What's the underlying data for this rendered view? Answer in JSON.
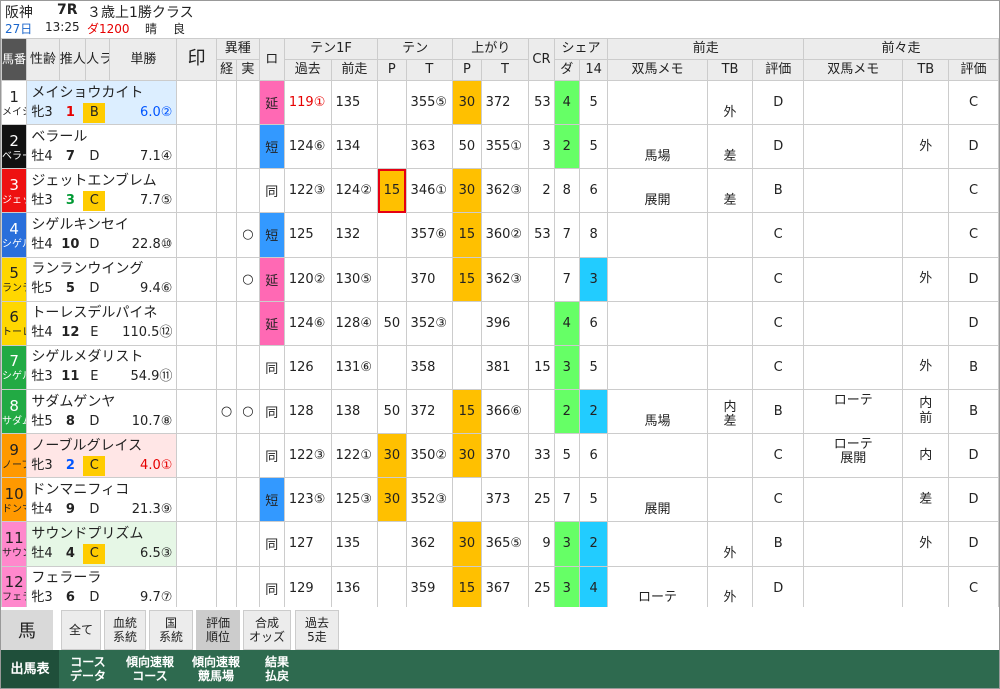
{
  "race": {
    "venue": "阪神",
    "round": "7R",
    "name": "３歳上1勝クラス",
    "day": "27日",
    "time": "13:25",
    "course": "ダ1200",
    "weather": "晴",
    "condition": "良"
  },
  "headers": {
    "umaban": "馬番↑",
    "seirei": "性齢",
    "suikan": "推人",
    "ninki": "人ラ",
    "tansho": "単勝",
    "shirushi": "印",
    "ishu": "異種",
    "ishu_kei": "経",
    "ishu_jitsu": "実",
    "ro": "ロ",
    "ten1f": "テン1F",
    "kako": "過去",
    "zenso_t": "前走",
    "ten": "テン",
    "p": "P",
    "t": "T",
    "agari": "上がり",
    "cr": "CR",
    "share": "シェア",
    "da": "ダ",
    "n14": "14",
    "zenso": "前走",
    "zenzenso": "前々走",
    "memo": "双馬メモ",
    "tb": "TB",
    "hyoka": "評価"
  },
  "horses": [
    {
      "num": "1",
      "abbr": "メイシ",
      "numColor": "#ffffff",
      "numText": "#222",
      "name": "メイショウカイト",
      "sex": "牝3",
      "ninki": "1",
      "ninkiColor": "red",
      "rank": "B",
      "rankHL": true,
      "odds": "6.0②",
      "oddsColor": "bluet",
      "kei": "",
      "jitsu": "",
      "ro": "延",
      "roColor": "bg-pink",
      "ten_kako": "119①",
      "ten_kakoColor": "red",
      "ten_zen": "135",
      "ten_zenColor": "",
      "ten_p": "",
      "ten_pColor": "",
      "ten_t": "355⑤",
      "ten_tColor": "",
      "agari_p": "30",
      "agari_pColor": "bg-yellow",
      "agari_t": "372",
      "agari_tColor": "",
      "cr": "53",
      "da": "4",
      "daColor": "bg-green",
      "n14": "5",
      "n14Color": "",
      "z_memo": "",
      "z_tb": "外",
      "z_hyoka": "D",
      "zz_memo": "",
      "zz_tb": "",
      "zz_hyoka": "C",
      "rowbg": "rowbg1"
    },
    {
      "num": "2",
      "abbr": "ベラー",
      "numColor": "#111111",
      "numText": "#fff",
      "name": "ベラール",
      "sex": "牡4",
      "ninki": "7",
      "ninkiColor": "",
      "rank": "D",
      "rankHL": false,
      "odds": "7.1④",
      "oddsColor": "",
      "kei": "",
      "jitsu": "",
      "ro": "短",
      "roColor": "bg-blue",
      "ten_kako": "124⑥",
      "ten_kakoColor": "",
      "ten_zen": "134",
      "ten_zenColor": "",
      "ten_p": "",
      "ten_pColor": "",
      "ten_t": "363",
      "ten_tColor": "",
      "agari_p": "50",
      "agari_pColor": "",
      "agari_t": "355①",
      "agari_tColor": "",
      "cr": "3",
      "da": "2",
      "daColor": "bg-green",
      "n14": "5",
      "n14Color": "",
      "z_memo": "馬場",
      "z_tb": "差",
      "z_hyoka": "D",
      "zz_memo": "",
      "zz_tb": "外",
      "zz_hyoka": "D",
      "rowbg": ""
    },
    {
      "num": "3",
      "abbr": "ジェッ",
      "numColor": "#ee1111",
      "numText": "#fff",
      "name": "ジェットエンブレム",
      "sex": "牡3",
      "ninki": "3",
      "ninkiColor": "green",
      "rank": "C",
      "rankHL": true,
      "odds": "7.7⑤",
      "oddsColor": "",
      "kei": "",
      "jitsu": "",
      "ro": "同",
      "roColor": "",
      "ten_kako": "122③",
      "ten_kakoColor": "",
      "ten_zen": "124②",
      "ten_zenColor": "",
      "ten_p": "15",
      "ten_pColor": "bg-yellow",
      "ten_t": "346①",
      "ten_tColor": "",
      "agari_p": "30",
      "agari_pColor": "bg-yellow",
      "agari_t": "362③",
      "agari_tColor": "",
      "cr": "2",
      "da": "8",
      "daColor": "",
      "n14": "6",
      "n14Color": "",
      "z_memo": "展開",
      "z_tb": "差",
      "z_hyoka": "B",
      "zz_memo": "",
      "zz_tb": "",
      "zz_hyoka": "C",
      "rowbg": ""
    },
    {
      "num": "4",
      "abbr": "シゲル",
      "numColor": "#2a6fdb",
      "numText": "#fff",
      "name": "シゲルキンセイ",
      "sex": "牡4",
      "ninki": "10",
      "ninkiColor": "",
      "rank": "D",
      "rankHL": false,
      "odds": "22.8⑩",
      "oddsColor": "",
      "kei": "",
      "jitsu": "○",
      "ro": "短",
      "roColor": "bg-blue",
      "ten_kako": "125",
      "ten_kakoColor": "",
      "ten_zen": "132",
      "ten_zenColor": "",
      "ten_p": "",
      "ten_pColor": "",
      "ten_t": "357⑥",
      "ten_tColor": "",
      "agari_p": "15",
      "agari_pColor": "bg-yellow",
      "agari_t": "360②",
      "agari_tColor": "",
      "cr": "53",
      "da": "7",
      "daColor": "",
      "n14": "8",
      "n14Color": "",
      "z_memo": "",
      "z_tb": "",
      "z_hyoka": "C",
      "zz_memo": "",
      "zz_tb": "",
      "zz_hyoka": "C",
      "rowbg": ""
    },
    {
      "num": "5",
      "abbr": "ランラ",
      "numColor": "#ffd700",
      "numText": "#222",
      "name": "ランランウイング",
      "sex": "牝5",
      "ninki": "5",
      "ninkiColor": "",
      "rank": "D",
      "rankHL": false,
      "odds": "9.4⑥",
      "oddsColor": "",
      "kei": "",
      "jitsu": "○",
      "ro": "延",
      "roColor": "bg-pink",
      "ten_kako": "120②",
      "ten_kakoColor": "",
      "ten_zen": "130⑤",
      "ten_zenColor": "",
      "ten_p": "",
      "ten_pColor": "",
      "ten_t": "370",
      "ten_tColor": "",
      "agari_p": "15",
      "agari_pColor": "bg-yellow",
      "agari_t": "362③",
      "agari_tColor": "",
      "cr": "",
      "da": "7",
      "daColor": "",
      "n14": "3",
      "n14Color": "bg-cyan",
      "z_memo": "",
      "z_tb": "",
      "z_hyoka": "C",
      "zz_memo": "",
      "zz_tb": "外",
      "zz_hyoka": "D",
      "rowbg": ""
    },
    {
      "num": "6",
      "abbr": "トーレ",
      "numColor": "#ffd700",
      "numText": "#222",
      "name": "トーレスデルパイネ",
      "sex": "牡4",
      "ninki": "12",
      "ninkiColor": "",
      "rank": "E",
      "rankHL": false,
      "odds": "110.5⑫",
      "oddsColor": "",
      "kei": "",
      "jitsu": "",
      "ro": "延",
      "roColor": "bg-pink",
      "ten_kako": "124⑥",
      "ten_kakoColor": "",
      "ten_zen": "128④",
      "ten_zenColor": "",
      "ten_p": "50",
      "ten_pColor": "",
      "ten_t": "352③",
      "ten_tColor": "",
      "agari_p": "",
      "agari_pColor": "",
      "agari_t": "396",
      "agari_tColor": "",
      "cr": "",
      "da": "4",
      "daColor": "bg-green",
      "n14": "6",
      "n14Color": "",
      "z_memo": "",
      "z_tb": "",
      "z_hyoka": "C",
      "zz_memo": "",
      "zz_tb": "",
      "zz_hyoka": "D",
      "rowbg": ""
    },
    {
      "num": "7",
      "abbr": "シゲル",
      "numColor": "#22aa44",
      "numText": "#fff",
      "name": "シゲルメダリスト",
      "sex": "牡3",
      "ninki": "11",
      "ninkiColor": "",
      "rank": "E",
      "rankHL": false,
      "odds": "54.9⑪",
      "oddsColor": "",
      "kei": "",
      "jitsu": "",
      "ro": "同",
      "roColor": "",
      "ten_kako": "126",
      "ten_kakoColor": "",
      "ten_zen": "131⑥",
      "ten_zenColor": "",
      "ten_p": "",
      "ten_pColor": "",
      "ten_t": "358",
      "ten_tColor": "",
      "agari_p": "",
      "agari_pColor": "",
      "agari_t": "381",
      "agari_tColor": "",
      "cr": "15",
      "da": "3",
      "daColor": "bg-green",
      "n14": "5",
      "n14Color": "",
      "z_memo": "",
      "z_tb": "",
      "z_hyoka": "C",
      "zz_memo": "",
      "zz_tb": "外",
      "zz_hyoka": "B",
      "rowbg": ""
    },
    {
      "num": "8",
      "abbr": "サダム",
      "numColor": "#22aa44",
      "numText": "#fff",
      "name": "サダムゲンヤ",
      "sex": "牡5",
      "ninki": "8",
      "ninkiColor": "",
      "rank": "D",
      "rankHL": false,
      "odds": "10.7⑧",
      "oddsColor": "",
      "kei": "○",
      "jitsu": "○",
      "ro": "同",
      "roColor": "",
      "ten_kako": "128",
      "ten_kakoColor": "",
      "ten_zen": "138",
      "ten_zenColor": "",
      "ten_p": "50",
      "ten_pColor": "",
      "ten_t": "372",
      "ten_tColor": "",
      "agari_p": "15",
      "agari_pColor": "bg-yellow",
      "agari_t": "366⑥",
      "agari_tColor": "",
      "cr": "",
      "da": "2",
      "daColor": "bg-green",
      "n14": "2",
      "n14Color": "bg-cyan",
      "z_memo": "馬場",
      "z_tb": "内\n差",
      "z_hyoka": "B",
      "zz_memo": "ローテ",
      "zz_tb": "内\n前",
      "zz_hyoka": "B",
      "rowbg": ""
    },
    {
      "num": "9",
      "abbr": "ノーブ",
      "numColor": "#ff9900",
      "numText": "#222",
      "name": "ノーブルグレイス",
      "sex": "牝3",
      "ninki": "2",
      "ninkiColor": "bluet",
      "rank": "C",
      "rankHL": true,
      "odds": "4.0①",
      "oddsColor": "red",
      "kei": "",
      "jitsu": "",
      "ro": "同",
      "roColor": "",
      "ten_kako": "122③",
      "ten_kakoColor": "",
      "ten_zen": "122①",
      "ten_zenColor": "",
      "ten_p": "30",
      "ten_pColor": "bg-yellow",
      "ten_t": "350②",
      "ten_tColor": "",
      "agari_p": "30",
      "agari_pColor": "bg-yellow",
      "agari_t": "370",
      "agari_tColor": "",
      "cr": "33",
      "da": "5",
      "daColor": "",
      "n14": "6",
      "n14Color": "",
      "z_memo": "",
      "z_tb": "",
      "z_hyoka": "C",
      "zz_memo": "ローテ\n展開",
      "zz_tb": "内",
      "zz_hyoka": "D",
      "rowbg": "rowbg2"
    },
    {
      "num": "10",
      "abbr": "ドンマ",
      "numColor": "#ff9900",
      "numText": "#222",
      "name": "ドンマニフィコ",
      "sex": "牡4",
      "ninki": "9",
      "ninkiColor": "",
      "rank": "D",
      "rankHL": false,
      "odds": "21.3⑨",
      "oddsColor": "",
      "kei": "",
      "jitsu": "",
      "ro": "短",
      "roColor": "bg-blue",
      "ten_kako": "123⑤",
      "ten_kakoColor": "",
      "ten_zen": "125③",
      "ten_zenColor": "",
      "ten_p": "30",
      "ten_pColor": "bg-yellow",
      "ten_t": "352③",
      "ten_tColor": "",
      "agari_p": "",
      "agari_pColor": "",
      "agari_t": "373",
      "agari_tColor": "",
      "cr": "25",
      "da": "7",
      "daColor": "",
      "n14": "5",
      "n14Color": "",
      "z_memo": "展開",
      "z_tb": "",
      "z_hyoka": "C",
      "zz_memo": "",
      "zz_tb": "差",
      "zz_hyoka": "D",
      "rowbg": ""
    },
    {
      "num": "11",
      "abbr": "サウン",
      "numColor": "#ff88cc",
      "numText": "#222",
      "name": "サウンドプリズム",
      "sex": "牡4",
      "ninki": "4",
      "ninkiColor": "",
      "rank": "C",
      "rankHL": true,
      "odds": "6.5③",
      "oddsColor": "",
      "kei": "",
      "jitsu": "",
      "ro": "同",
      "roColor": "",
      "ten_kako": "127",
      "ten_kakoColor": "",
      "ten_zen": "135",
      "ten_zenColor": "",
      "ten_p": "",
      "ten_pColor": "",
      "ten_t": "362",
      "ten_tColor": "",
      "agari_p": "30",
      "agari_pColor": "bg-yellow",
      "agari_t": "365⑤",
      "agari_tColor": "",
      "cr": "9",
      "da": "3",
      "daColor": "bg-green",
      "n14": "2",
      "n14Color": "bg-cyan",
      "z_memo": "",
      "z_tb": "外",
      "z_hyoka": "B",
      "zz_memo": "",
      "zz_tb": "外",
      "zz_hyoka": "D",
      "rowbg": "rowbg3"
    },
    {
      "num": "12",
      "abbr": "フェラ",
      "numColor": "#ff88cc",
      "numText": "#222",
      "name": "フェラーラ",
      "sex": "牝3",
      "ninki": "6",
      "ninkiColor": "",
      "rank": "D",
      "rankHL": false,
      "odds": "9.7⑦",
      "oddsColor": "",
      "kei": "",
      "jitsu": "",
      "ro": "同",
      "roColor": "",
      "ten_kako": "129",
      "ten_kakoColor": "",
      "ten_zen": "136",
      "ten_zenColor": "",
      "ten_p": "",
      "ten_pColor": "",
      "ten_t": "359",
      "ten_tColor": "",
      "agari_p": "15",
      "agari_pColor": "bg-yellow",
      "agari_t": "367",
      "agari_tColor": "",
      "cr": "25",
      "da": "3",
      "daColor": "bg-green",
      "n14": "4",
      "n14Color": "bg-cyan",
      "z_memo": "ローテ",
      "z_tb": "外",
      "z_hyoka": "D",
      "zz_memo": "",
      "zz_tb": "",
      "zz_hyoka": "C",
      "rowbg": ""
    }
  ],
  "toolbar": {
    "uma": "馬",
    "buttons": [
      "全て",
      "血統\n系統",
      "国\n系統",
      "評価\n順位",
      "合成\nオッズ",
      "過去\n5走"
    ],
    "active": "評価\n順位"
  },
  "bottom_tabs": [
    "出馬表",
    "コース\nデータ",
    "傾向速報\nコース",
    "傾向速報\n競馬場",
    "結果\n払戻"
  ],
  "bottom_active": "出馬表"
}
